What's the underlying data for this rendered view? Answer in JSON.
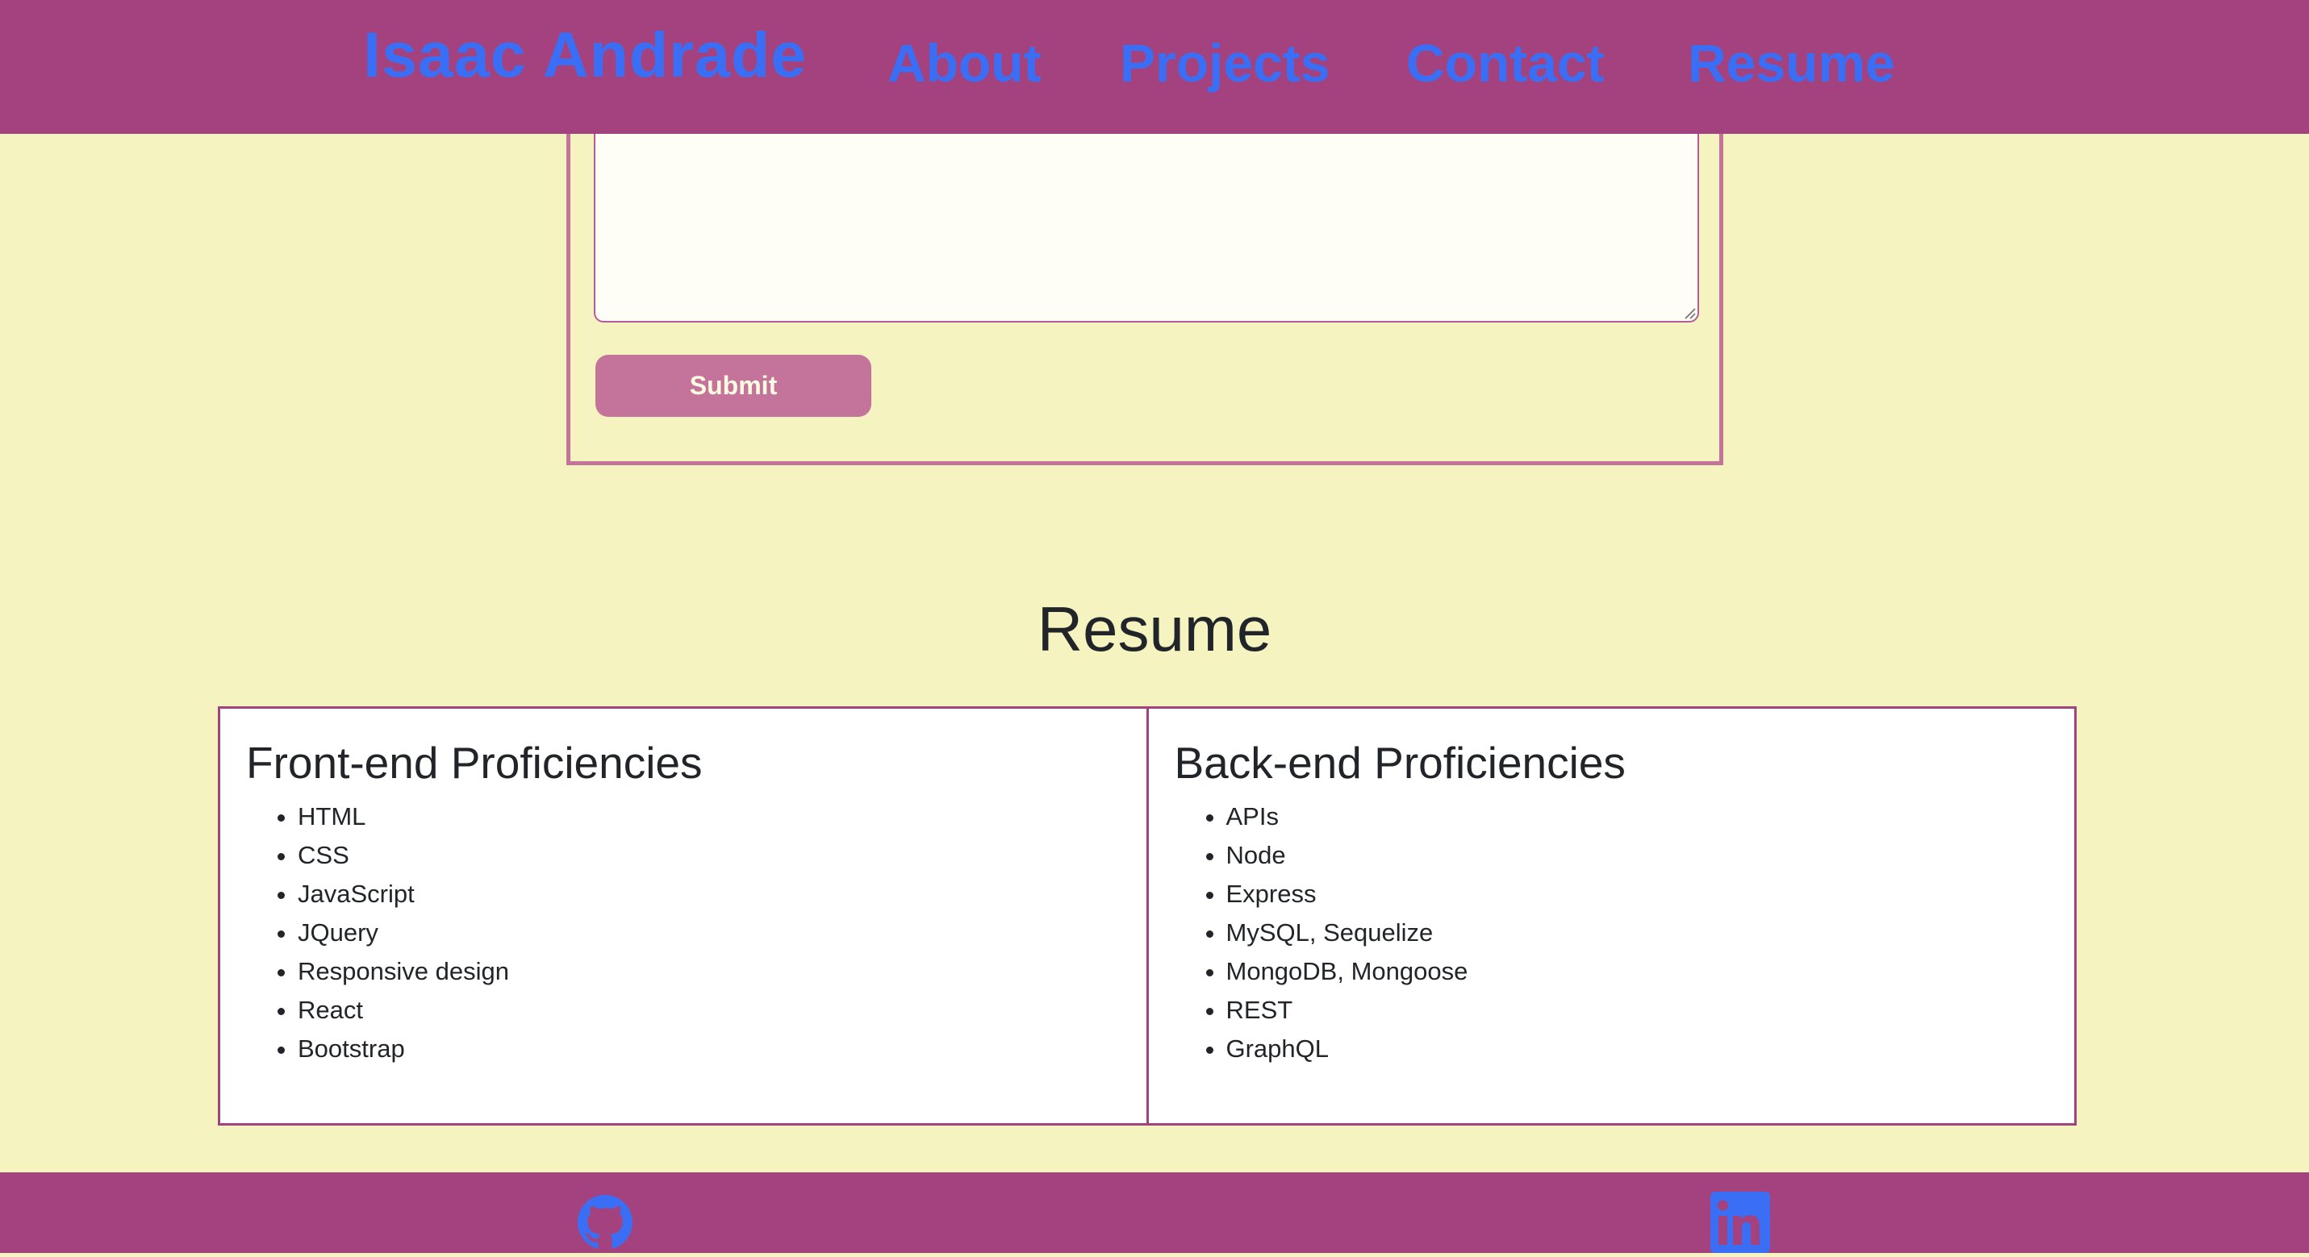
{
  "header": {
    "brand": "Isaac Andrade",
    "nav": {
      "about": "About",
      "projects": "Projects",
      "contact": "Contact",
      "resume": "Resume"
    }
  },
  "contact_form": {
    "message_value": "",
    "submit_label": "Submit"
  },
  "resume": {
    "title": "Resume",
    "frontend": {
      "heading": "Front-end Proficiencies",
      "items": [
        "HTML",
        "CSS",
        "JavaScript",
        "JQuery",
        "Responsive design",
        "React",
        "Bootstrap"
      ]
    },
    "backend": {
      "heading": "Back-end Proficiencies",
      "items": [
        "APIs",
        "Node",
        "Express",
        "MySQL, Sequelize",
        "MongoDB, Mongoose",
        "REST",
        "GraphQL"
      ]
    }
  },
  "footer": {
    "icons": [
      "github-icon",
      "linkedin-icon"
    ]
  },
  "colors": {
    "header_bg": "#a3427e",
    "page_bg": "#f5f4c0",
    "link": "#3a6ff5",
    "button": "#c4739b",
    "card_border": "#a3427e"
  }
}
